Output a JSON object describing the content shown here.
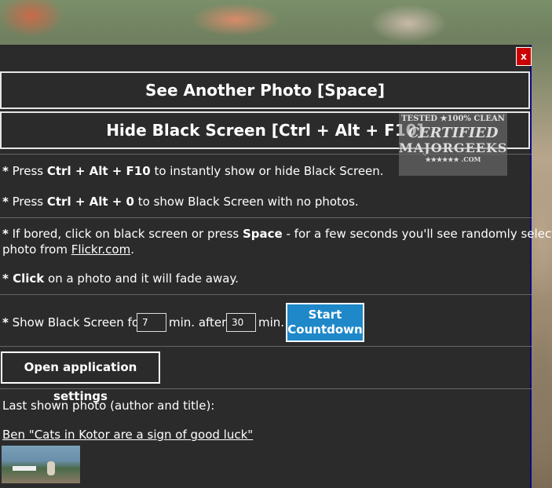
{
  "window": {
    "close_label": "x"
  },
  "buttons": {
    "see_another": "See Another Photo [Space]",
    "hide_black": "Hide Black Screen [Ctrl + Alt + F10]",
    "start_countdown_1": "Start",
    "start_countdown_2": "Countdown",
    "open_settings": "Open application settings"
  },
  "tips": {
    "t1_star": "*",
    "t1_a": " Press ",
    "t1_b": "Ctrl + Alt + F10",
    "t1_c": " to instantly show or hide Black Screen.",
    "t2_star": "*",
    "t2_a": " Press ",
    "t2_b": "Ctrl + Alt + 0",
    "t2_c": " to show Black Screen with no photos.",
    "t3_star": "*",
    "t3_a": " If bored, click on black screen or press ",
    "t3_b": "Space",
    "t3_c": " - for a few seconds you'll see randomly selected",
    "t3_d": "photo from ",
    "t3_link": "Flickr.com",
    "t3_e": ".",
    "t4_star": "*",
    "t4_b": " Click",
    "t4_c": " on a photo and it will fade away."
  },
  "timer": {
    "star": "*",
    "prefix": " Show Black Screen for",
    "show_minutes": "7",
    "mid": "min. after",
    "after_minutes": "30",
    "suffix": "min."
  },
  "last_photo": {
    "heading": "Last shown photo (author and title):",
    "link_text": "Ben \"Cats in Kotor are a sign of good luck\""
  },
  "watermark": {
    "line1": "TESTED ★100% CLEAN",
    "line2": "CERTIFIED",
    "line3": "MAJORGEEKS",
    "line4": "★★★★★★ .COM"
  },
  "colors": {
    "titlebar": "#000080",
    "panel": "#2b2b2b",
    "accent_button": "#1e88c9",
    "close": "#cc0000"
  }
}
